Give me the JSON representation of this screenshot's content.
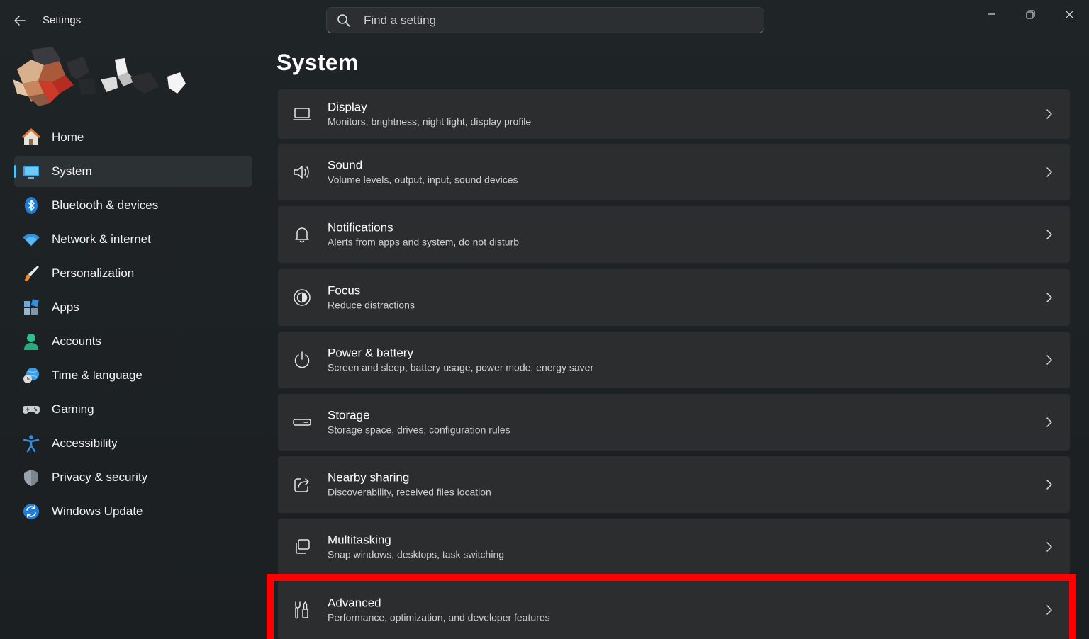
{
  "window": {
    "app_title": "Settings",
    "search_placeholder": "Find a setting"
  },
  "sidebar": {
    "items": [
      {
        "label": "Home",
        "icon": "home-icon"
      },
      {
        "label": "System",
        "icon": "system-icon",
        "selected": true
      },
      {
        "label": "Bluetooth & devices",
        "icon": "bluetooth-icon"
      },
      {
        "label": "Network & internet",
        "icon": "wifi-icon"
      },
      {
        "label": "Personalization",
        "icon": "brush-icon"
      },
      {
        "label": "Apps",
        "icon": "apps-icon"
      },
      {
        "label": "Accounts",
        "icon": "accounts-icon"
      },
      {
        "label": "Time & language",
        "icon": "clock-globe-icon"
      },
      {
        "label": "Gaming",
        "icon": "gamepad-icon"
      },
      {
        "label": "Accessibility",
        "icon": "accessibility-icon"
      },
      {
        "label": "Privacy & security",
        "icon": "shield-icon"
      },
      {
        "label": "Windows Update",
        "icon": "update-icon"
      }
    ]
  },
  "main": {
    "title": "System",
    "cards": [
      {
        "title": "Display",
        "subtitle": "Monitors, brightness, night light, display profile",
        "icon": "display-icon"
      },
      {
        "title": "Sound",
        "subtitle": "Volume levels, output, input, sound devices",
        "icon": "speaker-icon"
      },
      {
        "title": "Notifications",
        "subtitle": "Alerts from apps and system, do not disturb",
        "icon": "bell-icon"
      },
      {
        "title": "Focus",
        "subtitle": "Reduce distractions",
        "icon": "focus-icon"
      },
      {
        "title": "Power & battery",
        "subtitle": "Screen and sleep, battery usage, power mode, energy saver",
        "icon": "power-icon"
      },
      {
        "title": "Storage",
        "subtitle": "Storage space, drives, configuration rules",
        "icon": "storage-icon"
      },
      {
        "title": "Nearby sharing",
        "subtitle": "Discoverability, received files location",
        "icon": "share-icon"
      },
      {
        "title": "Multitasking",
        "subtitle": "Snap windows, desktops, task switching",
        "icon": "multitasking-icon"
      },
      {
        "title": "Advanced",
        "subtitle": "Performance, optimization, and developer features",
        "icon": "tools-icon",
        "highlighted": true
      }
    ]
  },
  "colors": {
    "accent": "#4cc2ff",
    "highlight": "#ff0000",
    "card_bg": "#2b2d2f",
    "window_bg": "#1c2022"
  }
}
